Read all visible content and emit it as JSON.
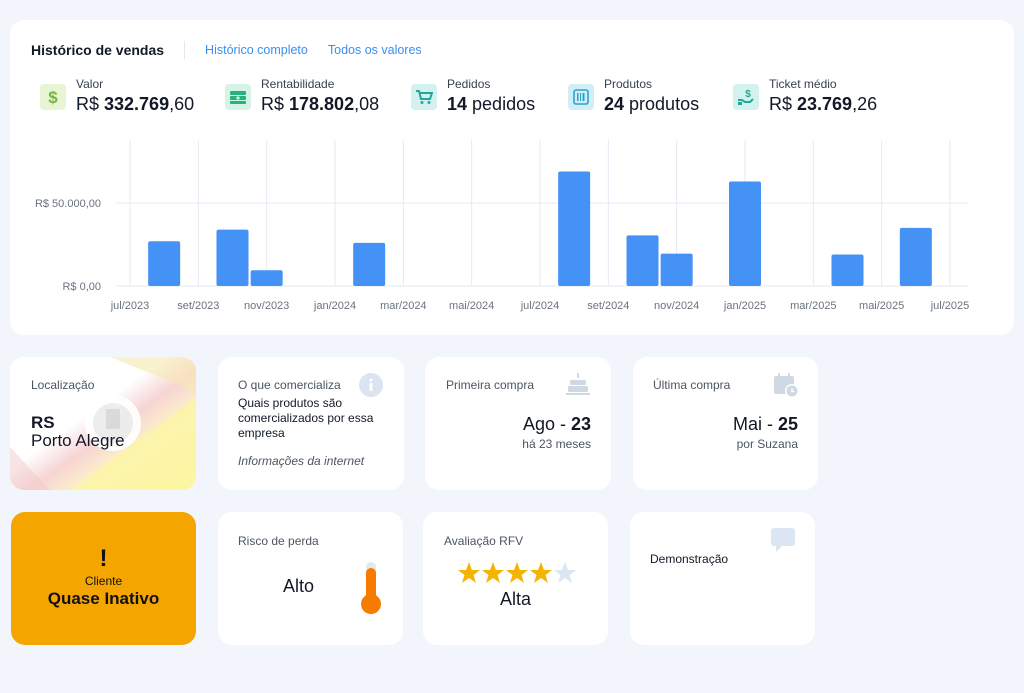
{
  "header": {
    "title": "Histórico de vendas",
    "links": [
      "Histórico completo",
      "Todos os valores"
    ]
  },
  "kpis": [
    {
      "label": "Valor",
      "prefix": "R$ ",
      "bold": "332.769",
      "suffix": ",60",
      "icon": "dollar-icon",
      "icon_color": "#8bc34a",
      "icon_bg": "#e8f5d5"
    },
    {
      "label": "Rentabilidade",
      "prefix": "R$ ",
      "bold": "178.802",
      "suffix": ",08",
      "icon": "money-stack-icon",
      "icon_color": "#26b37a",
      "icon_bg": "#d5f3e7"
    },
    {
      "label": "Pedidos",
      "prefix": "",
      "bold": "14",
      "suffix": " pedidos",
      "icon": "cart-icon",
      "icon_color": "#26a69a",
      "icon_bg": "#d3f1ee"
    },
    {
      "label": "Produtos",
      "prefix": "",
      "bold": "24",
      "suffix": " produtos",
      "icon": "barcode-icon",
      "icon_color": "#26a5c9",
      "icon_bg": "#d3edf6"
    },
    {
      "label": "Ticket médio",
      "prefix": "R$ ",
      "bold": "23.769",
      "suffix": ",26",
      "icon": "hand-money-icon",
      "icon_color": "#26a69a",
      "icon_bg": "#d3f1ee"
    }
  ],
  "chart_data": {
    "type": "bar",
    "x_tick_labels": [
      "jul/2023",
      "set/2023",
      "nov/2023",
      "jan/2024",
      "mar/2024",
      "mai/2024",
      "jul/2024",
      "set/2024",
      "nov/2024",
      "jan/2025",
      "mar/2025",
      "mai/2025",
      "jul/2025"
    ],
    "months": [
      "jul/2023",
      "ago/2023",
      "set/2023",
      "out/2023",
      "nov/2023",
      "dez/2023",
      "jan/2024",
      "fev/2024",
      "mar/2024",
      "abr/2024",
      "mai/2024",
      "jun/2024",
      "jul/2024",
      "ago/2024",
      "set/2024",
      "out/2024",
      "nov/2024",
      "dez/2024",
      "jan/2025",
      "fev/2025",
      "mar/2025",
      "abr/2025",
      "mai/2025",
      "jun/2025",
      "jul/2025"
    ],
    "values": [
      0,
      27000,
      0,
      34000,
      9500,
      0,
      0,
      26000,
      0,
      0,
      0,
      0,
      0,
      69000,
      0,
      30500,
      19500,
      0,
      63000,
      0,
      0,
      19000,
      0,
      35000,
      0
    ],
    "y_tick_labels": [
      "R$ 0,00",
      "R$ 50.000,00"
    ],
    "y_ticks": [
      0,
      50000
    ],
    "ylim": [
      0,
      88000
    ],
    "bar_color": "#4592f7",
    "grid": true
  },
  "cards": {
    "location": {
      "label": "Localização",
      "state": "RS",
      "city": "Porto Alegre"
    },
    "sells": {
      "label": "O que comercializa",
      "text": "Quais produtos são comercializados por essa empresa",
      "source": "Informações da internet",
      "icon": "info-icon"
    },
    "first_purchase": {
      "label": "Primeira compra",
      "month": "Ago",
      "year": "23",
      "ago": "há 23 meses",
      "icon": "cake-icon"
    },
    "last_purchase": {
      "label": "Última compra",
      "month": "Mai",
      "year": "25",
      "by": "por Suzana",
      "icon": "calendar-clock-icon"
    },
    "status": {
      "mark": "!",
      "label": "Cliente",
      "value": "Quase Inativo",
      "color": "#f5a500"
    },
    "risk": {
      "label": "Risco de perda",
      "value": "Alto",
      "icon": "thermometer-icon",
      "level": 0.85
    },
    "rfv": {
      "label": "Avaliação RFV",
      "stars": 4,
      "max_stars": 5,
      "value": "Alta"
    },
    "demo": {
      "label": "Demonstração",
      "icon": "chat-bubble-icon"
    }
  }
}
